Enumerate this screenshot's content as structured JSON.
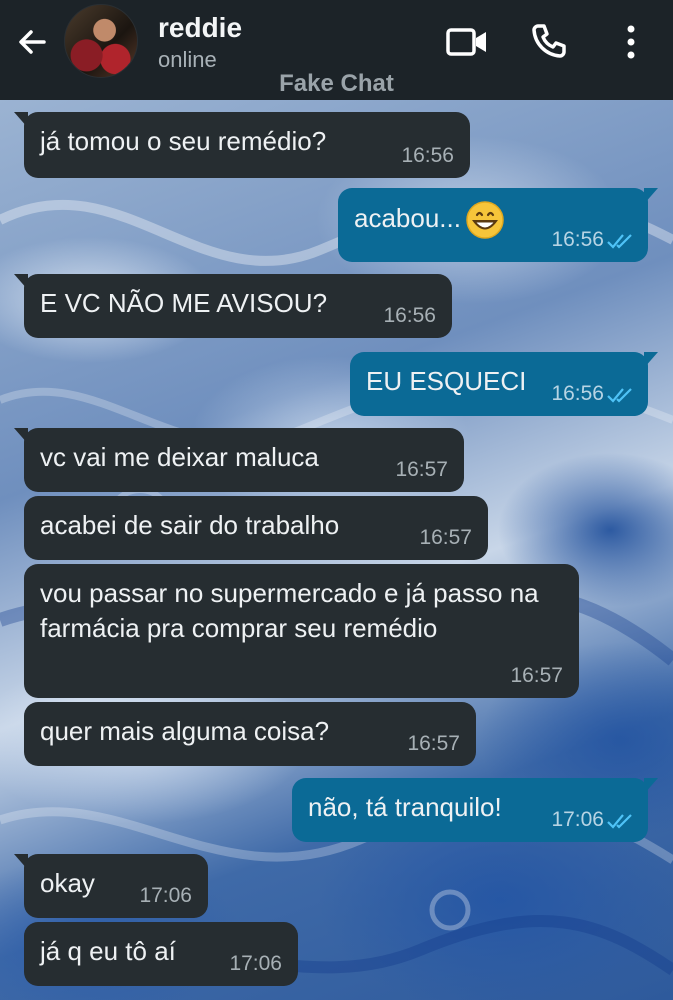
{
  "header": {
    "contact_name": "reddie",
    "status": "online",
    "app_label": "Fake Chat",
    "icons": [
      "back-arrow-icon",
      "video-call-icon",
      "phone-icon",
      "more-vertical-icon"
    ]
  },
  "colors": {
    "header_bg": "#1c2328",
    "incoming_bubble": "#262d31",
    "outgoing_bubble": "#0b6a96",
    "read_ticks": "#4fc3f7"
  },
  "messages": [
    {
      "direction": "in",
      "text": "já tomou o seu remédio?",
      "time": "16:56"
    },
    {
      "direction": "out",
      "text": "acabou...",
      "emoji": "grinning-face",
      "time": "16:56",
      "read": true
    },
    {
      "direction": "in",
      "text": "E VC NÃO ME AVISOU?",
      "time": "16:56"
    },
    {
      "direction": "out",
      "text": "EU ESQUECI",
      "time": "16:56",
      "read": true
    },
    {
      "direction": "in",
      "text": "vc vai me deixar maluca",
      "time": "16:57"
    },
    {
      "direction": "in",
      "text": "acabei de sair do trabalho",
      "time": "16:57"
    },
    {
      "direction": "in",
      "text": "vou passar no supermercado e já passo na farmácia pra comprar seu remédio",
      "time": "16:57"
    },
    {
      "direction": "in",
      "text": "quer mais alguma coisa?",
      "time": "16:57"
    },
    {
      "direction": "out",
      "text": "não, tá tranquilo!",
      "time": "17:06",
      "read": true
    },
    {
      "direction": "in",
      "text": "okay",
      "time": "17:06"
    },
    {
      "direction": "in",
      "text": "já q eu tô aí",
      "time": "17:06"
    }
  ]
}
